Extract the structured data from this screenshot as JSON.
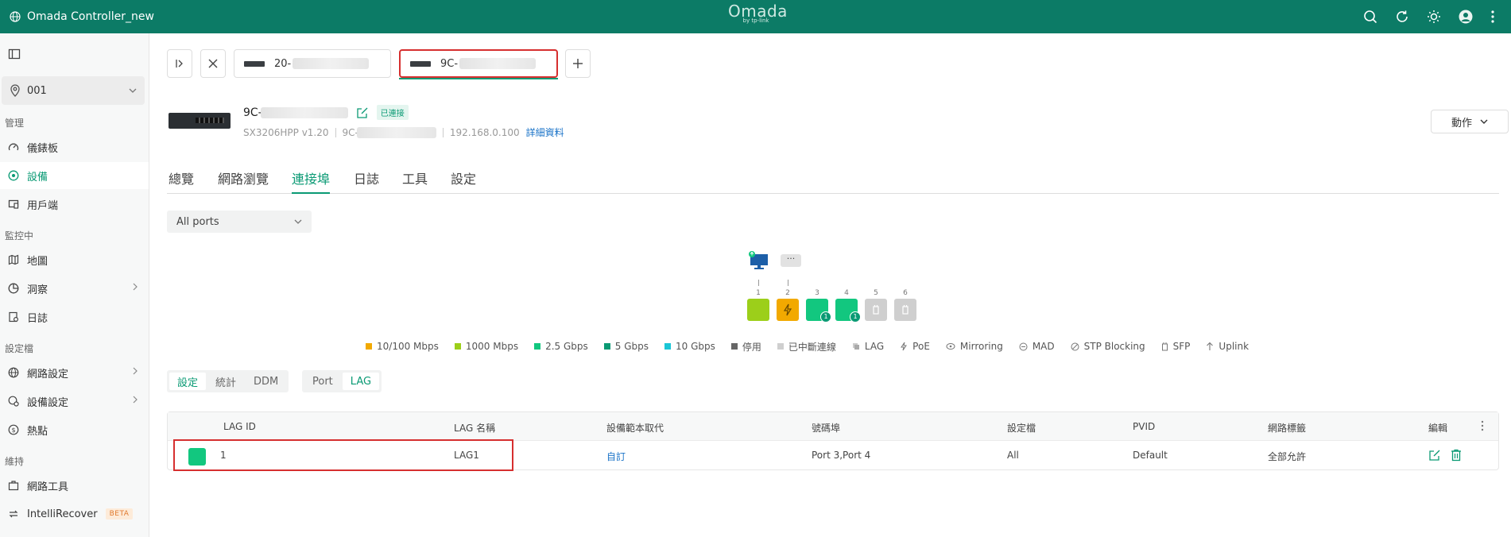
{
  "topbar": {
    "site_label": "Omada Controller_new",
    "logo_text": "Omada",
    "logo_sub": "by tp-link",
    "icons": [
      "search-icon",
      "refresh-icon",
      "theme-icon",
      "avatar-icon",
      "more-vertical-icon"
    ]
  },
  "sidebar": {
    "site_selector": "001",
    "sections": {
      "manage": "管理",
      "monitor": "監控中",
      "config": "設定檔",
      "maintain": "維持"
    },
    "items": {
      "dashboard": "儀錶板",
      "devices": "設備",
      "clients": "用戶端",
      "map": "地圖",
      "insight": "洞察",
      "logs": "日誌",
      "network_settings": "網路設定",
      "device_settings": "設備設定",
      "hotspot": "熱點",
      "network_tools": "網路工具",
      "intellirecover": "IntelliRecover",
      "beta": "BETA"
    }
  },
  "device_tabs": [
    {
      "label": "20-",
      "selected": false
    },
    {
      "label": "9C-",
      "selected": true
    }
  ],
  "device": {
    "name": "9C-",
    "status": "已連接",
    "model": "SX3206HPP v1.20",
    "mac_prefix": "9C-",
    "ip": "192.168.0.100",
    "details_link": "詳細資料",
    "action_button": "動作"
  },
  "nav_tabs": [
    "總覽",
    "網路瀏覽",
    "連接埠",
    "日誌",
    "工具",
    "設定"
  ],
  "active_nav_tab": "連接埠",
  "port_filter": "All ports",
  "more_label": "···",
  "ports": [
    {
      "num": "1",
      "color": "#9ccf1a"
    },
    {
      "num": "2",
      "color": "#f2a900"
    },
    {
      "num": "3",
      "color": "#12c77f",
      "badge": "1"
    },
    {
      "num": "4",
      "color": "#12c77f",
      "badge": "1"
    },
    {
      "num": "5",
      "color": "#cfcfcf"
    },
    {
      "num": "6",
      "color": "#cfcfcf"
    }
  ],
  "legend": [
    {
      "label": "10/100 Mbps",
      "color": "#f2a900"
    },
    {
      "label": "1000 Mbps",
      "color": "#9ccf1a"
    },
    {
      "label": "2.5 Gbps",
      "color": "#12c77f"
    },
    {
      "label": "5 Gbps",
      "color": "#0a9a74"
    },
    {
      "label": "10 Gbps",
      "color": "#1bc6d6"
    },
    {
      "label": "停用",
      "color": "#666666"
    },
    {
      "label": "已中斷連線",
      "color": "#cfcfcf"
    },
    {
      "label": "LAG",
      "icon": "lag-icon"
    },
    {
      "label": "PoE",
      "icon": "poe-icon"
    },
    {
      "label": "Mirroring",
      "icon": "mirroring-icon"
    },
    {
      "label": "MAD",
      "icon": "mad-icon"
    },
    {
      "label": "STP Blocking",
      "icon": "stp-icon"
    },
    {
      "label": "SFP",
      "icon": "sfp-icon"
    },
    {
      "label": "Uplink",
      "icon": "uplink-icon"
    }
  ],
  "view_segment": [
    "設定",
    "統計",
    "DDM"
  ],
  "view_segment_active": "設定",
  "type_segment": [
    "Port",
    "LAG"
  ],
  "type_segment_active": "LAG",
  "table": {
    "headers": [
      "LAG ID",
      "LAG 名稱",
      "設備範本取代",
      "號碼埠",
      "設定檔",
      "PVID",
      "網路標籤",
      "編輯"
    ],
    "rows": [
      {
        "lag_id": "1",
        "lag_name": "LAG1",
        "template": "自訂",
        "ports": "Port 3,Port 4",
        "profile": "All",
        "pvid": "Default",
        "tag": "全部允許"
      }
    ]
  }
}
